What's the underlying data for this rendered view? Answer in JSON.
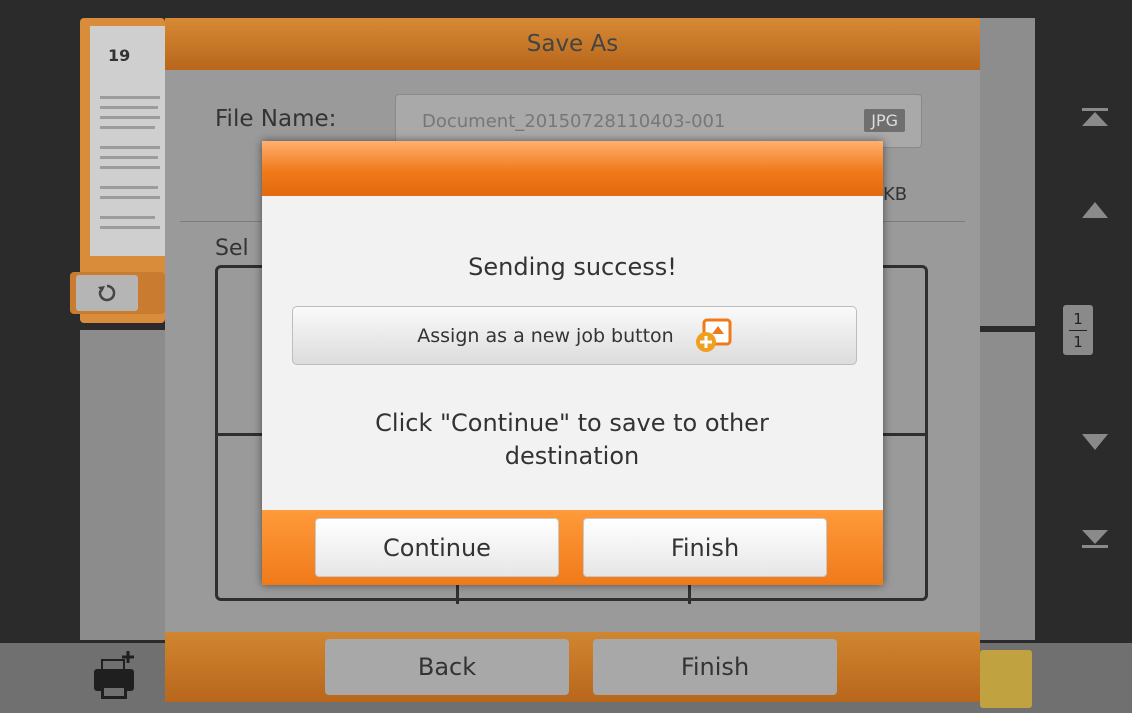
{
  "background": {
    "thumbnail_page_number": "19",
    "dialog_title": "Save As",
    "file_name_label": "File Name:",
    "file_name_value": "Document_20150728110403-001",
    "file_format": "JPG",
    "file_size_fragment": "KB",
    "select_fragment": "Sel",
    "page_indicator": {
      "current": "1",
      "total": "1"
    },
    "back_label": "Back",
    "finish_label": "Finish"
  },
  "modal": {
    "message": "Sending success!",
    "assign_label": "Assign as a new job button",
    "instructions": "Click \"Continue\" to save to other destination",
    "continue_label": "Continue",
    "finish_label": "Finish"
  },
  "icons": {
    "rotate": "rotate-icon",
    "assign": "assign-job-icon",
    "printer": "printer-add-icon"
  },
  "colors": {
    "accent": "#f07a1a"
  }
}
